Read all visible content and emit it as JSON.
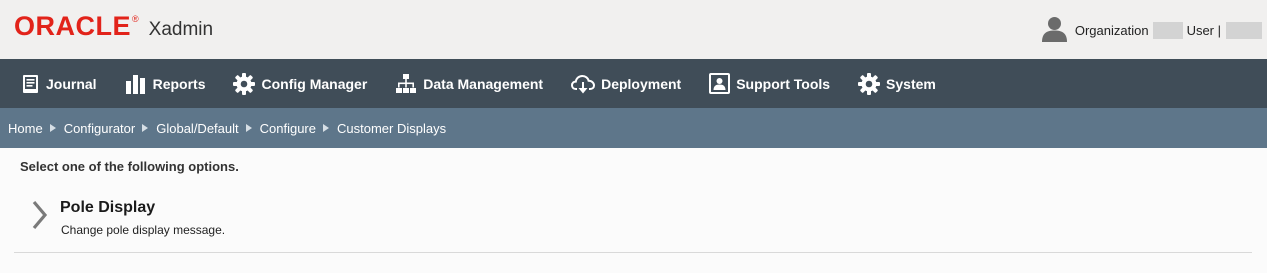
{
  "header": {
    "logo_text": "ORACLE",
    "app_name": "Xadmin",
    "organization_label": "Organization",
    "user_label": "User |",
    "colors": {
      "brand": "#e2231a",
      "header_bg": "#f1f0ef"
    }
  },
  "nav": {
    "items": [
      {
        "label": "Journal",
        "icon": "journal-icon"
      },
      {
        "label": "Reports",
        "icon": "bar-chart-icon"
      },
      {
        "label": "Config Manager",
        "icon": "gear-icon"
      },
      {
        "label": "Data Management",
        "icon": "hierarchy-icon"
      },
      {
        "label": "Deployment",
        "icon": "cloud-download-icon"
      },
      {
        "label": "Support Tools",
        "icon": "support-icon"
      },
      {
        "label": "System",
        "icon": "gear-icon"
      }
    ],
    "colors": {
      "bg": "#404d58",
      "text": "#ffffff"
    }
  },
  "breadcrumb": {
    "items": [
      "Home",
      "Configurator",
      "Global/Default",
      "Configure",
      "Customer Displays"
    ],
    "colors": {
      "bg": "#5e768a"
    }
  },
  "main": {
    "instructions": "Select one of the following options.",
    "options": [
      {
        "title": "Pole Display",
        "description": "Change pole display message.",
        "icon": "chevron-right-icon"
      }
    ]
  }
}
